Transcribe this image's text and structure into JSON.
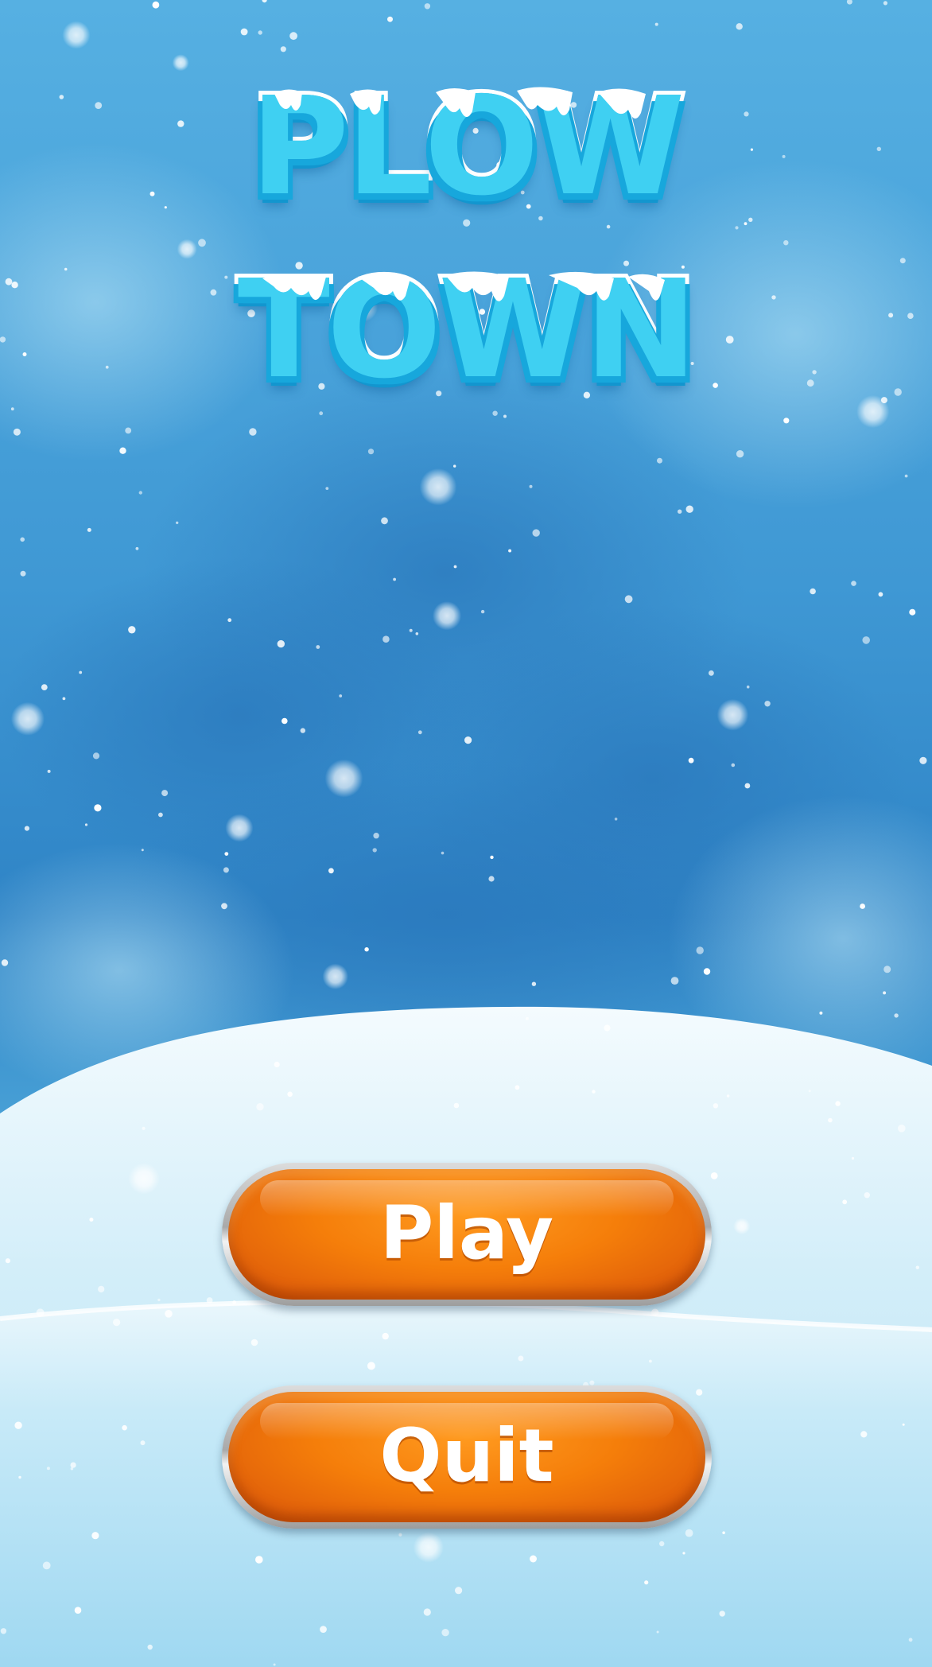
{
  "game": {
    "title_line1": "PLOW",
    "title_line2": "TOWN"
  },
  "menu": {
    "play_label": "Play",
    "quit_label": "Quit"
  },
  "colors": {
    "sky_top": "#4aa6dc",
    "sky_mid": "#2f86c8",
    "snow_hill": "#e9f6fb",
    "title_fill": "#3fd0f2",
    "title_outline": "#ffffff",
    "title_shadow": "#17a7dc",
    "button_orange": "#f57e0a",
    "button_rim": "#b8b8b8",
    "button_text": "#ffffff"
  }
}
